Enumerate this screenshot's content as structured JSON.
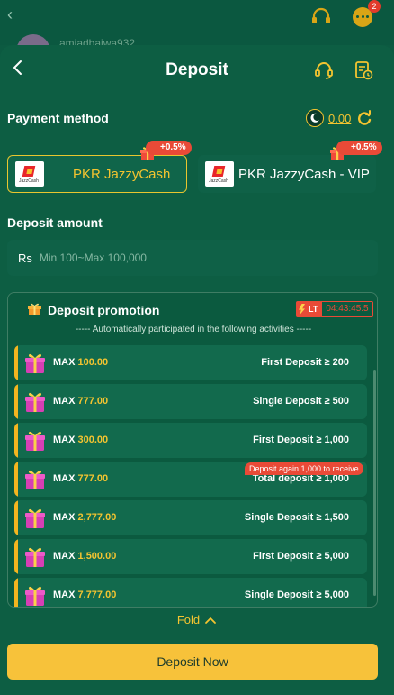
{
  "background_app": {
    "username": "amjadbajwa932",
    "notification_count": "2"
  },
  "header": {
    "title": "Deposit"
  },
  "payment_method": {
    "title": "Payment method",
    "balance": "0.00",
    "options": [
      {
        "label": "PKR JazzyCash",
        "bonus": "+0.5%",
        "selected": true,
        "logo_text": "JazzCash"
      },
      {
        "label": "PKR JazzyCash - VIP",
        "bonus": "+0.5%",
        "selected": false,
        "logo_text": "JazzCash"
      }
    ]
  },
  "deposit_amount": {
    "title": "Deposit amount",
    "currency": "Rs",
    "placeholder": "Min 100~Max 100,000"
  },
  "promotion": {
    "title": "Deposit promotion",
    "lt_label": "LT",
    "countdown": "04:43:45.5",
    "subtitle": "----- Automatically participated in the following activities -----",
    "max_label": "MAX",
    "items": [
      {
        "amount": "100.00",
        "condition": "First Deposit ≥ 200"
      },
      {
        "amount": "777.00",
        "condition": "Single Deposit ≥ 500"
      },
      {
        "amount": "300.00",
        "condition": "First Deposit ≥ 1,000"
      },
      {
        "amount": "777.00",
        "condition": "Total deposit ≥ 1,000",
        "note": "Deposit again 1,000 to receive"
      },
      {
        "amount": "2,777.00",
        "condition": "Single Deposit ≥ 1,500"
      },
      {
        "amount": "1,500.00",
        "condition": "First Deposit ≥ 5,000"
      },
      {
        "amount": "7,777.00",
        "condition": "Single Deposit ≥ 5,000"
      }
    ]
  },
  "fold_label": "Fold",
  "deposit_button": "Deposit Now",
  "colors": {
    "background": "#0c5a41",
    "accent_gold": "#f4c430",
    "badge_red": "#e94a37",
    "button_yellow": "#f7c23a"
  },
  "icons": [
    "back-arrow-icon",
    "headset-icon",
    "history-icon",
    "pk-flag-icon",
    "refresh-icon",
    "gift-icon",
    "chevron-up-icon",
    "chat-icon"
  ]
}
